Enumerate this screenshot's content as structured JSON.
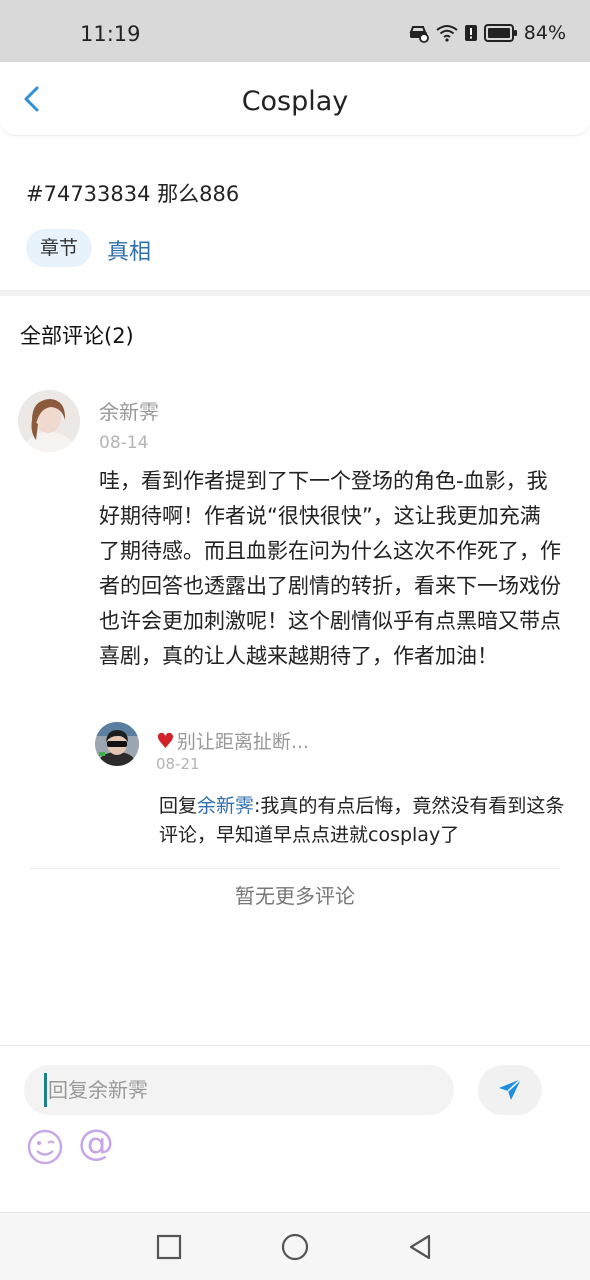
{
  "status_bar": {
    "time": "11:19",
    "battery": "84%"
  },
  "header": {
    "title": "Cosplay"
  },
  "post": {
    "info": "#74733834 那么886",
    "tag_label": "章节",
    "tag_link": "真相"
  },
  "comments": {
    "title": "全部评论(2)",
    "main": {
      "author": "余新霁",
      "date": "08-14",
      "text": "哇，看到作者提到了下一个登场的角色-血影，我好期待啊！作者说“很快很快”，这让我更加充满了期待感。而且血影在问为什么这次不作死了，作者的回答也透露出了剧情的转折，看来下一场戏份也许会更加刺激呢！这个剧情似乎有点黑暗又带点喜剧，真的让人越来越期待了，作者加油！"
    },
    "reply": {
      "author": "别让距离扯断...",
      "date": "08-21",
      "prefix": "回复",
      "mention": "余新霁",
      "text": ":我真的有点后悔，竟然没有看到这条评论，早知道早点点进就cosplay了"
    },
    "no_more": "暂无更多评论"
  },
  "input": {
    "placeholder": "回复余新霁"
  },
  "colors": {
    "accent": "#2f6fae",
    "send": "#1e8fe0",
    "emoji": "#c6a6e6"
  }
}
